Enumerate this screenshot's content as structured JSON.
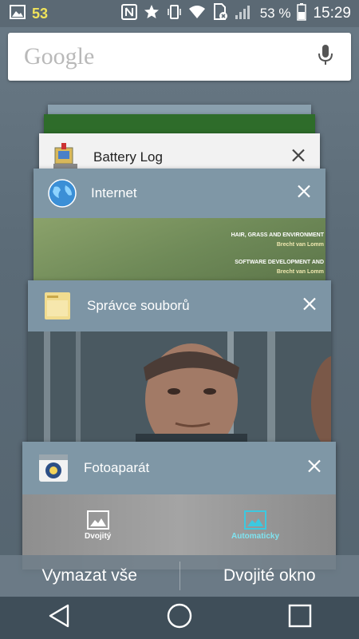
{
  "status_bar": {
    "notification_count": "53",
    "battery_percent": "53 %",
    "time": "15:29"
  },
  "search": {
    "logo": "Google",
    "mic_icon": "microphone-icon"
  },
  "recent_apps": [
    {
      "title": "Battery Log",
      "icon": "battery-log-icon"
    },
    {
      "title": "Internet",
      "icon": "globe-icon",
      "content_lines": [
        "HAIR, GRASS AND ENVIRONMENT",
        "Brecht van Lomm",
        "SOFTWARE DEVELOPMENT AND",
        "Brecht van Lomm"
      ]
    },
    {
      "title": "Správce souborů",
      "icon": "folder-icon"
    },
    {
      "title": "Fotoaparát",
      "icon": "camera-icon",
      "modes": [
        "Dvojitý",
        "Automaticky"
      ]
    }
  ],
  "actions": {
    "clear_all": "Vymazat vše",
    "dual_window": "Dvojité okno"
  },
  "nav": [
    "back-icon",
    "home-icon",
    "recents-icon"
  ]
}
